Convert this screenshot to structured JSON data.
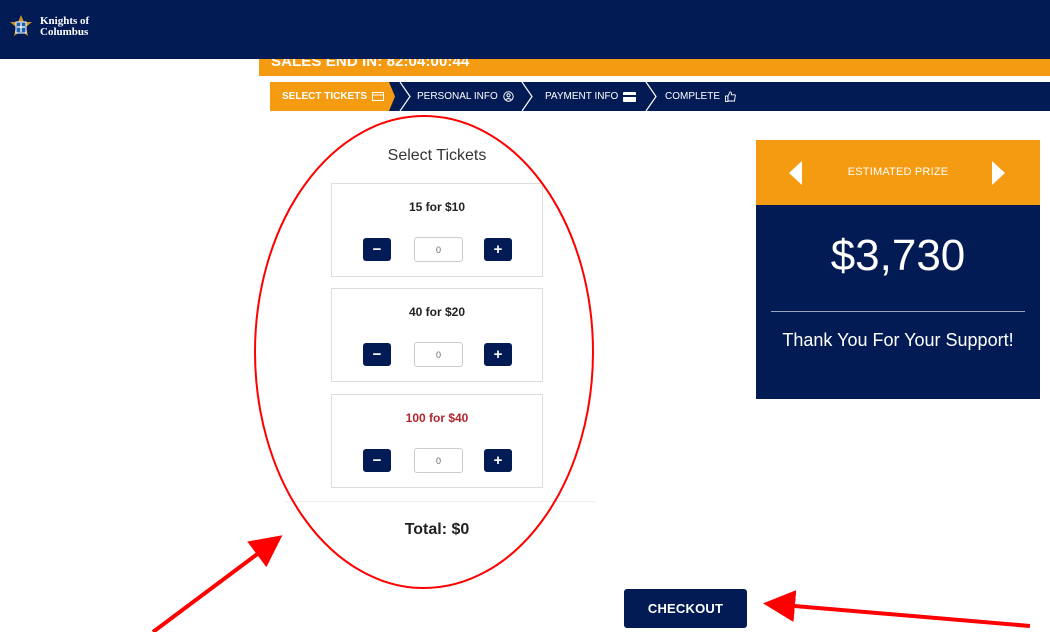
{
  "header": {
    "brand_line_1": "Knights of",
    "brand_line_2": "Columbus",
    "logo_icon": "knights-of-columbus-emblem-icon"
  },
  "sales": {
    "countdown": "SALES END IN: 82:04:00:44"
  },
  "steps": [
    {
      "label": "SELECT TICKETS",
      "icon": "ticket-icon",
      "active": true
    },
    {
      "label": "PERSONAL INFO",
      "icon": "user-circle-icon",
      "active": false
    },
    {
      "label": "PAYMENT INFO",
      "icon": "credit-card-icon",
      "active": false
    },
    {
      "label": "COMPLETE",
      "icon": "thumbs-up-icon",
      "active": false
    }
  ],
  "tickets": {
    "title": "Select Tickets",
    "options": [
      {
        "label": "15 for $10",
        "quantity": "0"
      },
      {
        "label": "40 for $20",
        "quantity": "0"
      },
      {
        "label": "100 for $40",
        "quantity": "0"
      }
    ],
    "minus": "−",
    "plus": "+",
    "total": "Total: $0"
  },
  "prize": {
    "title": "ESTIMATED PRIZE",
    "amount": "$3,730",
    "message": "Thank You For Your Support!"
  },
  "checkout": {
    "label": "CHECKOUT"
  },
  "colors": {
    "navy": "#031b54",
    "orange": "#f59b12",
    "annotation_red": "#ff0000"
  }
}
